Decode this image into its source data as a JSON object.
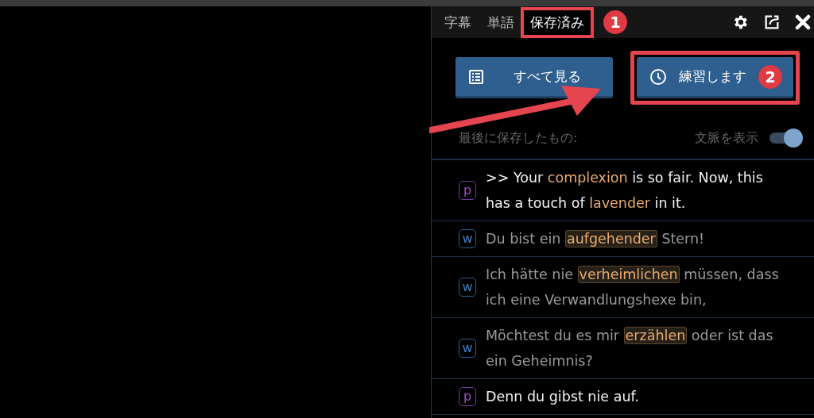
{
  "tabs": [
    {
      "label": "字幕",
      "selected": false,
      "marked": false
    },
    {
      "label": "単語",
      "selected": false,
      "marked": false
    },
    {
      "label": "保存済み",
      "selected": true,
      "marked": true,
      "callout": "1"
    }
  ],
  "actions": [
    {
      "label": "すべて見る",
      "marked": false
    },
    {
      "label": "練習します",
      "marked": true,
      "callout": "2"
    }
  ],
  "saved_label": "最後に保存したもの:",
  "context_toggle": {
    "label": "文脈を表示",
    "on": true
  },
  "entries": [
    {
      "kind": "p",
      "segments": [
        {
          "text": ">> Your ",
          "highlight": false
        },
        {
          "text": "complexion",
          "highlight": true
        },
        {
          "text": " is so fair. Now, this has a touch of ",
          "highlight": false
        },
        {
          "text": "lavender",
          "highlight": true
        },
        {
          "text": " in it.",
          "highlight": false
        }
      ]
    },
    {
      "kind": "w",
      "segments": [
        {
          "text": "Du bist ein ",
          "highlight": false
        },
        {
          "text": "aufgehender",
          "highlight": true
        },
        {
          "text": " Stern!",
          "highlight": false
        }
      ]
    },
    {
      "kind": "w",
      "segments": [
        {
          "text": "Ich hätte nie ",
          "highlight": false
        },
        {
          "text": "verheimlichen",
          "highlight": true
        },
        {
          "text": " müssen, dass ich eine Verwandlungshexe bin,",
          "highlight": false
        }
      ]
    },
    {
      "kind": "w",
      "segments": [
        {
          "text": "Möchtest du es mir ",
          "highlight": false
        },
        {
          "text": "erzählen",
          "highlight": true
        },
        {
          "text": " oder ist das ein Geheimnis?",
          "highlight": false
        }
      ]
    },
    {
      "kind": "p",
      "segments": [
        {
          "text": "Denn du gibst nie auf.",
          "highlight": false
        }
      ]
    }
  ]
}
